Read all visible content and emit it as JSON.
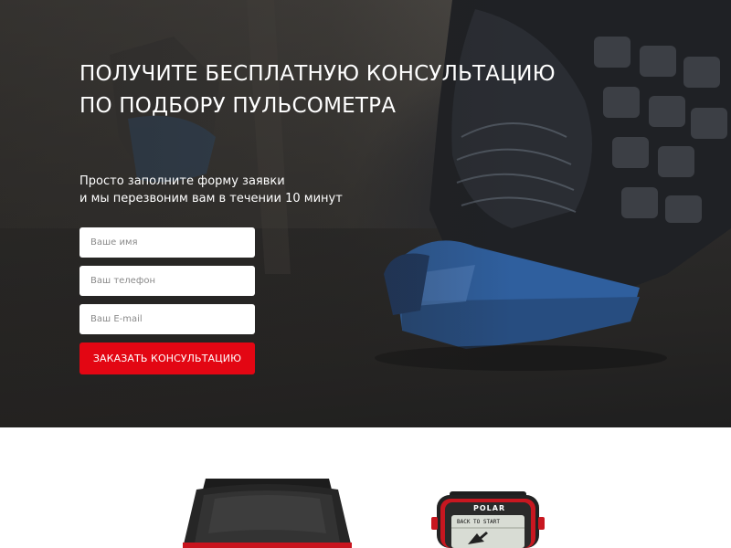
{
  "hero": {
    "title_lines": [
      "ПОЛУЧИТЕ БЕСПЛАТНУЮ КОНСУЛЬТАЦИЮ",
      "ПО ПОДБОРУ ПУЛЬСОМЕТРА"
    ],
    "subtitle_lines": [
      "Просто заполните форму заявки",
      "и мы перезвоним вам в течении 10 минут"
    ],
    "background_image": "running-shoe-on-treadmill"
  },
  "form": {
    "name_placeholder": "Ваше имя",
    "phone_placeholder": "Ваш телефон",
    "email_placeholder": "Ваш E-mail",
    "submit_label": "ЗАКАЗАТЬ КОНСУЛЬТАЦИЮ"
  },
  "products": {
    "watch_2_brand": "POLAR",
    "watch_2_screen_text": "BACK TO START"
  },
  "colors": {
    "accent": "#e30613",
    "hero_text": "#ffffff",
    "input_bg": "#ffffff"
  }
}
